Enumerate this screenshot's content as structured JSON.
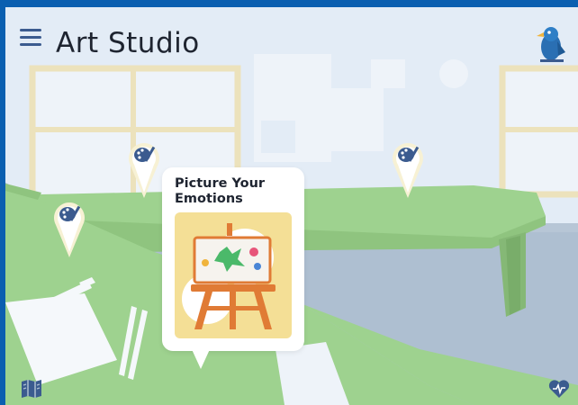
{
  "header": {
    "title": "Art Studio"
  },
  "popup": {
    "title_line1": "Picture Your",
    "title_line2": "Emotions"
  },
  "icons": {
    "menu": "hamburger-menu-icon",
    "logo": "blue-bird-logo-icon",
    "pin": "paint-palette-map-pin-icon",
    "bottom_left": "map-book-icon",
    "bottom_right": "heart-icon"
  },
  "colors": {
    "frame": "#0b5fb0",
    "sky": "#e3ecf6",
    "table": "#9ed28f",
    "accent_blue": "#3b5b8f",
    "card_image": "#f4df96"
  }
}
